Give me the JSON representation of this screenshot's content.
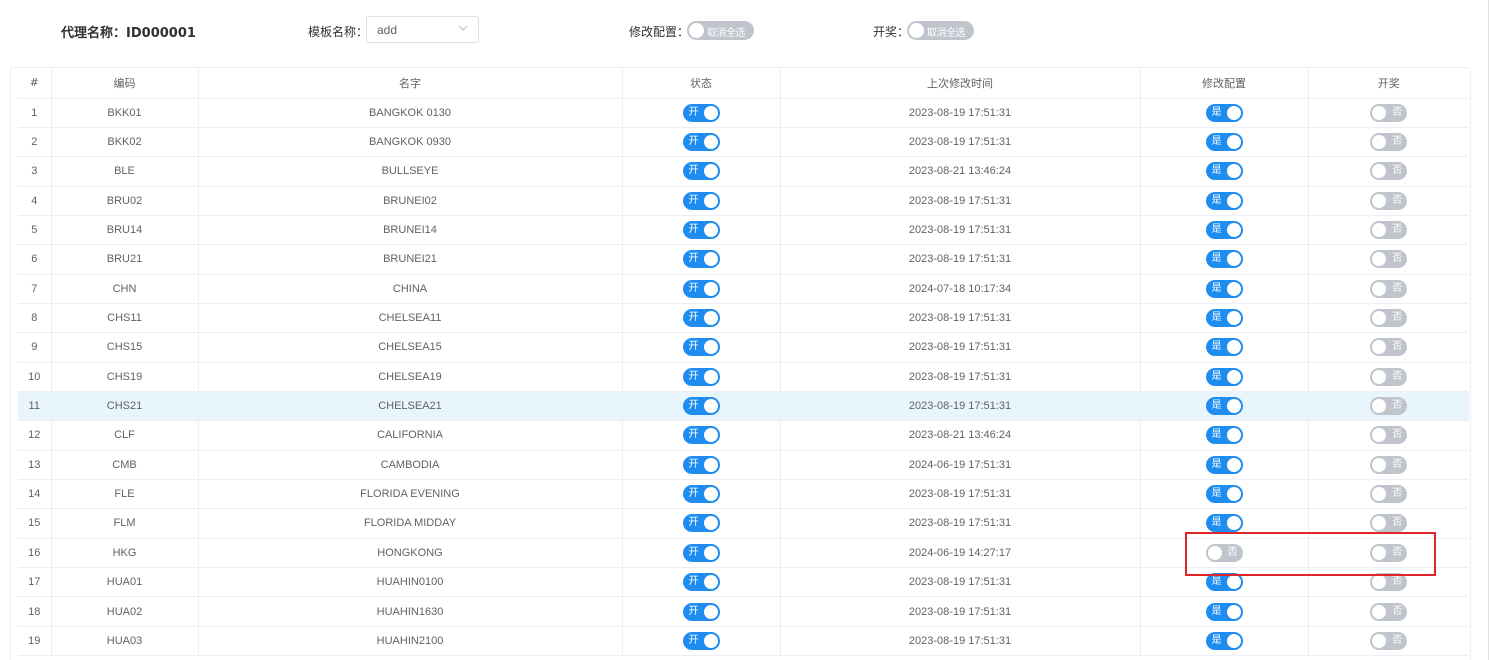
{
  "header": {
    "agent_label": "代理名称：",
    "agent_id": "ID000001",
    "template_label": "模板名称：",
    "template_value": "add",
    "modify_config_label": "修改配置：",
    "modify_config_switch_text": "取消全选",
    "lottery_label": "开奖：",
    "lottery_switch_text": "取消全选"
  },
  "table": {
    "columns": [
      "#",
      "编码",
      "名字",
      "状态",
      "上次修改时间",
      "修改配置",
      "开奖"
    ],
    "rows": [
      {
        "idx": "1",
        "code": "BKK01",
        "name": "BANGKOK 0130",
        "status": "开",
        "time": "2023-08-19 17:51:31",
        "config": "是",
        "config_on": true,
        "lottery": "否",
        "lottery_on": false
      },
      {
        "idx": "2",
        "code": "BKK02",
        "name": "BANGKOK 0930",
        "status": "开",
        "time": "2023-08-19 17:51:31",
        "config": "是",
        "config_on": true,
        "lottery": "否",
        "lottery_on": false
      },
      {
        "idx": "3",
        "code": "BLE",
        "name": "BULLSEYE",
        "status": "开",
        "time": "2023-08-21 13:46:24",
        "config": "是",
        "config_on": true,
        "lottery": "否",
        "lottery_on": false
      },
      {
        "idx": "4",
        "code": "BRU02",
        "name": "BRUNEI02",
        "status": "开",
        "time": "2023-08-19 17:51:31",
        "config": "是",
        "config_on": true,
        "lottery": "否",
        "lottery_on": false
      },
      {
        "idx": "5",
        "code": "BRU14",
        "name": "BRUNEI14",
        "status": "开",
        "time": "2023-08-19 17:51:31",
        "config": "是",
        "config_on": true,
        "lottery": "否",
        "lottery_on": false
      },
      {
        "idx": "6",
        "code": "BRU21",
        "name": "BRUNEI21",
        "status": "开",
        "time": "2023-08-19 17:51:31",
        "config": "是",
        "config_on": true,
        "lottery": "否",
        "lottery_on": false
      },
      {
        "idx": "7",
        "code": "CHN",
        "name": "CHINA",
        "status": "开",
        "time": "2024-07-18 10:17:34",
        "config": "是",
        "config_on": true,
        "lottery": "否",
        "lottery_on": false
      },
      {
        "idx": "8",
        "code": "CHS11",
        "name": "CHELSEA11",
        "status": "开",
        "time": "2023-08-19 17:51:31",
        "config": "是",
        "config_on": true,
        "lottery": "否",
        "lottery_on": false
      },
      {
        "idx": "9",
        "code": "CHS15",
        "name": "CHELSEA15",
        "status": "开",
        "time": "2023-08-19 17:51:31",
        "config": "是",
        "config_on": true,
        "lottery": "否",
        "lottery_on": false
      },
      {
        "idx": "10",
        "code": "CHS19",
        "name": "CHELSEA19",
        "status": "开",
        "time": "2023-08-19 17:51:31",
        "config": "是",
        "config_on": true,
        "lottery": "否",
        "lottery_on": false
      },
      {
        "idx": "11",
        "code": "CHS21",
        "name": "CHELSEA21",
        "status": "开",
        "time": "2023-08-19 17:51:31",
        "config": "是",
        "config_on": true,
        "lottery": "否",
        "lottery_on": false,
        "highlighted": true
      },
      {
        "idx": "12",
        "code": "CLF",
        "name": "CALIFORNIA",
        "status": "开",
        "time": "2023-08-21 13:46:24",
        "config": "是",
        "config_on": true,
        "lottery": "否",
        "lottery_on": false
      },
      {
        "idx": "13",
        "code": "CMB",
        "name": "CAMBODIA",
        "status": "开",
        "time": "2024-06-19 17:51:31",
        "config": "是",
        "config_on": true,
        "lottery": "否",
        "lottery_on": false
      },
      {
        "idx": "14",
        "code": "FLE",
        "name": "FLORIDA EVENING",
        "status": "开",
        "time": "2023-08-19 17:51:31",
        "config": "是",
        "config_on": true,
        "lottery": "否",
        "lottery_on": false
      },
      {
        "idx": "15",
        "code": "FLM",
        "name": "FLORIDA MIDDAY",
        "status": "开",
        "time": "2023-08-19 17:51:31",
        "config": "是",
        "config_on": true,
        "lottery": "否",
        "lottery_on": false
      },
      {
        "idx": "16",
        "code": "HKG",
        "name": "HONGKONG",
        "status": "开",
        "time": "2024-06-19 14:27:17",
        "config": "否",
        "config_on": false,
        "lottery": "否",
        "lottery_on": false
      },
      {
        "idx": "17",
        "code": "HUA01",
        "name": "HUAHIN0100",
        "status": "开",
        "time": "2023-08-19 17:51:31",
        "config": "是",
        "config_on": true,
        "lottery": "否",
        "lottery_on": false
      },
      {
        "idx": "18",
        "code": "HUA02",
        "name": "HUAHIN1630",
        "status": "开",
        "time": "2023-08-19 17:51:31",
        "config": "是",
        "config_on": true,
        "lottery": "否",
        "lottery_on": false
      },
      {
        "idx": "19",
        "code": "HUA03",
        "name": "HUAHIN2100",
        "status": "开",
        "time": "2023-08-19 17:51:31",
        "config": "是",
        "config_on": true,
        "lottery": "否",
        "lottery_on": false
      }
    ]
  },
  "colors": {
    "switch_on": "#1f8cf0",
    "switch_off": "#c0c4cc",
    "row_highlight": "#e8f5fc",
    "annotation": "#e0252b"
  },
  "icons": {
    "select_arrow": "chevron-down-icon"
  }
}
